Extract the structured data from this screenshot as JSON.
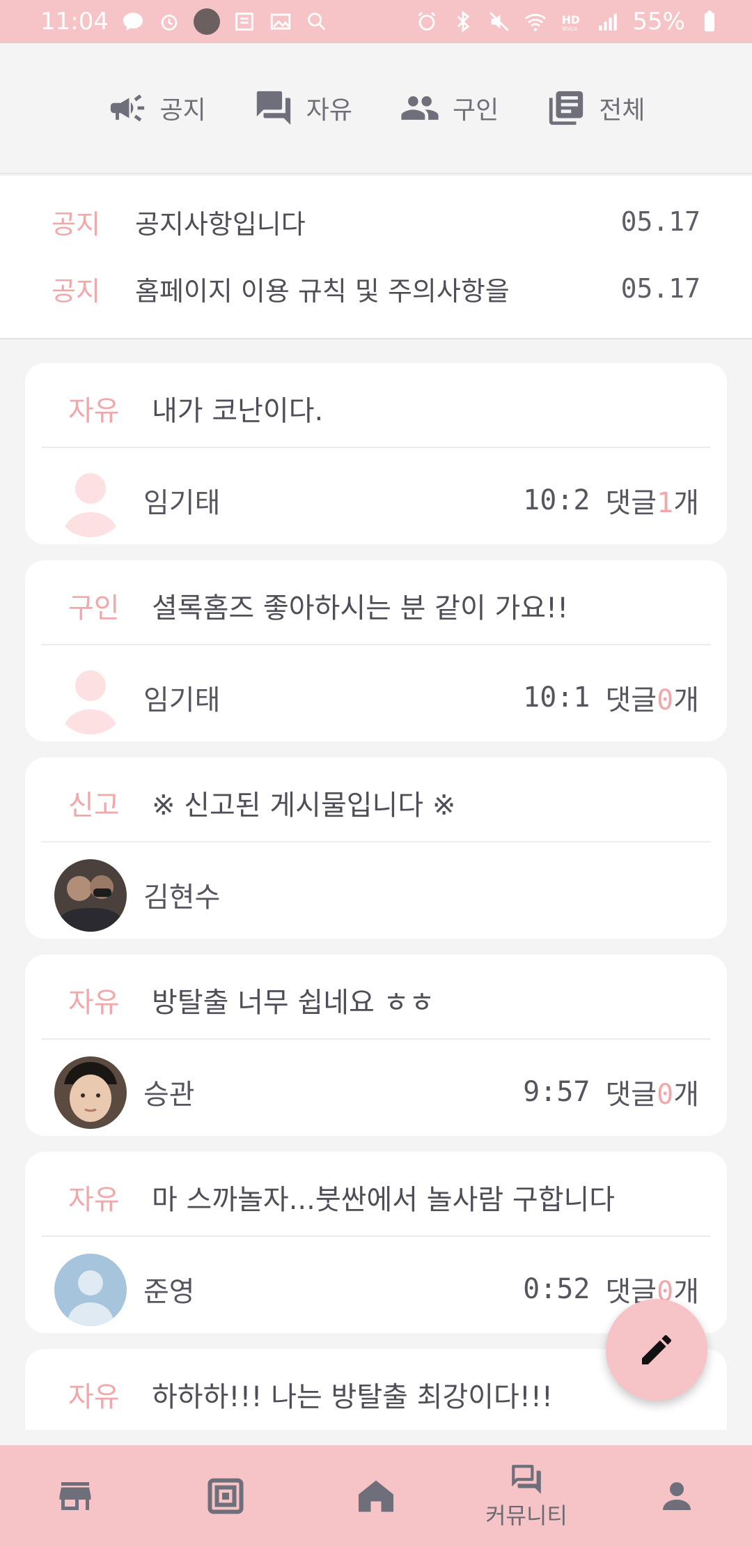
{
  "status_bar": {
    "time": "11:04",
    "battery": "55%",
    "left_icons": [
      "talk-icon",
      "alarm-clock-icon",
      "avatar-icon",
      "news-icon",
      "gallery-icon",
      "search-icon"
    ],
    "right_icons": [
      "alarm-icon",
      "bluetooth-icon",
      "mute-icon",
      "wifi-icon",
      "hd-voice-icon",
      "signal-icon",
      "battery-icon"
    ]
  },
  "category_tabs": [
    {
      "label": "공지",
      "icon": "megaphone-icon"
    },
    {
      "label": "자유",
      "icon": "chat-icon"
    },
    {
      "label": "구인",
      "icon": "people-icon"
    },
    {
      "label": "전체",
      "icon": "list-icon"
    }
  ],
  "notices": [
    {
      "tag": "공지",
      "title": "공지사항입니다",
      "date": "05.17"
    },
    {
      "tag": "공지",
      "title": "홈페이지 이용 규칙 및 주의사항을",
      "date": "05.17"
    }
  ],
  "posts": [
    {
      "category": "자유",
      "title": "내가 코난이다.",
      "author": "임기태",
      "avatar": "default-pink",
      "time": "10:2",
      "comment_label": "댓글",
      "comment_count": "1",
      "comment_unit": "개"
    },
    {
      "category": "구인",
      "title": "셜록홈즈 좋아하시는 분 같이 가요!!",
      "author": "임기태",
      "avatar": "default-pink",
      "time": "10:1",
      "comment_label": "댓글",
      "comment_count": "0",
      "comment_unit": "개"
    },
    {
      "category": "신고",
      "title": "※ 신고된 게시물입니다 ※",
      "author": "김현수",
      "avatar": "photo-dark",
      "time": "",
      "comment_label": "",
      "comment_count": "",
      "comment_unit": ""
    },
    {
      "category": "자유",
      "title": "방탈출 너무 쉽네요 ㅎㅎ",
      "author": "승관",
      "avatar": "photo-face",
      "time": "9:57",
      "comment_label": "댓글",
      "comment_count": "0",
      "comment_unit": "개"
    },
    {
      "category": "자유",
      "title": "마 스까놀자...붓싼에서 놀사람 구합니다",
      "author": "준영",
      "avatar": "default-blue",
      "time": "0:52",
      "comment_label": "댓글",
      "comment_count": "0",
      "comment_unit": "개"
    },
    {
      "category": "자유",
      "title": "하하하!!! 나는 방탈출 최강이다!!!",
      "author": "",
      "avatar": "",
      "time": "",
      "comment_label": "",
      "comment_count": "",
      "comment_unit": ""
    }
  ],
  "fab": {
    "icon": "pencil-icon"
  },
  "bottom_nav": [
    {
      "icon": "store-icon",
      "label": ""
    },
    {
      "icon": "frame-icon",
      "label": ""
    },
    {
      "icon": "home-icon",
      "label": ""
    },
    {
      "icon": "community-icon",
      "label": "커뮤니티"
    },
    {
      "icon": "person-icon",
      "label": ""
    }
  ],
  "colors": {
    "accent_pink": "#f6c4c6",
    "tag_pink": "#f2a7ab",
    "icon_gray": "#6f6f7c",
    "background": "#f4f4f5"
  }
}
